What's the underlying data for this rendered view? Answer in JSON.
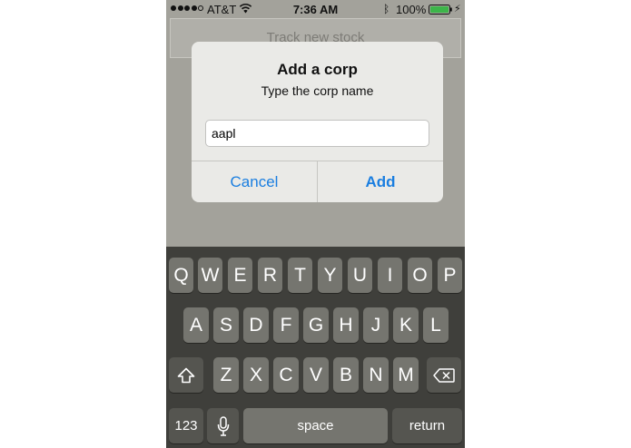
{
  "status_bar": {
    "carrier": "AT&T",
    "time": "7:36 AM",
    "battery": "100%",
    "signal_bars": 4,
    "icons": [
      "wifi-icon",
      "bluetooth-icon",
      "battery-icon",
      "charging-bolt-icon"
    ]
  },
  "background": {
    "track_button_label": "Track new stock"
  },
  "alert": {
    "title": "Add a corp",
    "message": "Type the corp name",
    "input_value": "aapl",
    "cancel_label": "Cancel",
    "add_label": "Add",
    "button_color": "#1a7ee0"
  },
  "keyboard": {
    "row1": [
      "Q",
      "W",
      "E",
      "R",
      "T",
      "Y",
      "U",
      "I",
      "O",
      "P"
    ],
    "row2": [
      "A",
      "S",
      "D",
      "F",
      "G",
      "H",
      "J",
      "K",
      "L"
    ],
    "row3": [
      "Z",
      "X",
      "C",
      "V",
      "B",
      "N",
      "M"
    ],
    "numbers_label": "123",
    "space_label": "space",
    "return_label": "return",
    "icons": [
      "shift-icon",
      "delete-icon",
      "microphone-icon"
    ]
  }
}
